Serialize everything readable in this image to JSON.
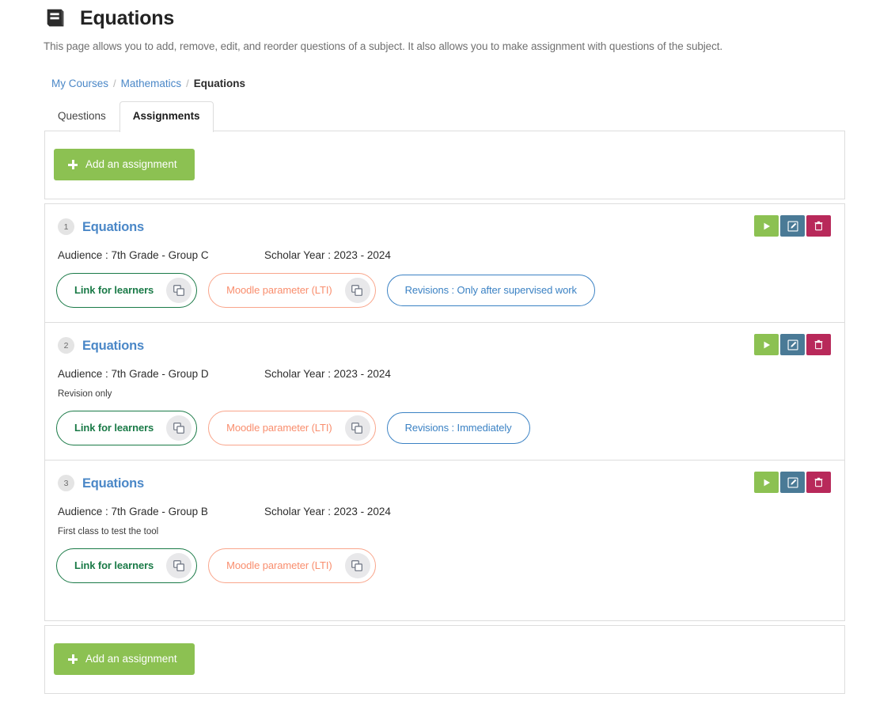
{
  "header": {
    "icon": "book-icon",
    "title": "Equations",
    "description": "This page allows you to add, remove, edit, and reorder questions of a subject. It also allows you to make assignment with questions of the subject."
  },
  "breadcrumb": {
    "items": [
      "My Courses",
      "Mathematics",
      "Equations"
    ],
    "separator": "/"
  },
  "tabs": [
    {
      "label": "Questions",
      "active": false
    },
    {
      "label": "Assignments",
      "active": true
    }
  ],
  "toolbar": {
    "add_label": "Add an assignment",
    "add_icon": "plus-icon",
    "add_color": "#8cc152"
  },
  "assignments": [
    {
      "number": "1",
      "title": "Equations",
      "audience": "Audience : 7th Grade - Group C",
      "scholar_year": "Scholar Year : 2023 - 2024",
      "note": "",
      "pills": [
        {
          "label": "Link for learners",
          "style": "green",
          "icon": "copy-icon",
          "has_icon": true
        },
        {
          "label": "Moodle parameter (LTI)",
          "style": "orange",
          "icon": "copy-icon",
          "has_icon": true
        },
        {
          "label": "Revisions : Only after supervised work",
          "style": "blue",
          "has_icon": false
        }
      ],
      "actions": [
        {
          "name": "play-button",
          "icon": "play-icon",
          "color": "#8cc152"
        },
        {
          "name": "edit-button",
          "icon": "pencil-square-icon",
          "color": "#4a7a96"
        },
        {
          "name": "delete-button",
          "icon": "trash-icon",
          "color": "#b8295a"
        }
      ]
    },
    {
      "number": "2",
      "title": "Equations",
      "audience": "Audience : 7th Grade - Group D",
      "scholar_year": "Scholar Year : 2023 - 2024",
      "note": "Revision only",
      "pills": [
        {
          "label": "Link for learners",
          "style": "green",
          "icon": "copy-icon",
          "has_icon": true
        },
        {
          "label": "Moodle parameter (LTI)",
          "style": "orange",
          "icon": "copy-icon",
          "has_icon": true
        },
        {
          "label": "Revisions : Immediately",
          "style": "blue",
          "has_icon": false
        }
      ],
      "actions": [
        {
          "name": "play-button",
          "icon": "play-icon",
          "color": "#8cc152"
        },
        {
          "name": "edit-button",
          "icon": "pencil-square-icon",
          "color": "#4a7a96"
        },
        {
          "name": "delete-button",
          "icon": "trash-icon",
          "color": "#b8295a"
        }
      ]
    },
    {
      "number": "3",
      "title": "Equations",
      "audience": "Audience : 7th Grade - Group B",
      "scholar_year": "Scholar Year : 2023 - 2024",
      "note": "First class to test the tool",
      "pills": [
        {
          "label": "Link for learners",
          "style": "green",
          "icon": "copy-icon",
          "has_icon": true
        },
        {
          "label": "Moodle parameter (LTI)",
          "style": "orange",
          "icon": "copy-icon",
          "has_icon": true
        }
      ],
      "actions": [
        {
          "name": "play-button",
          "icon": "play-icon",
          "color": "#8cc152"
        },
        {
          "name": "edit-button",
          "icon": "pencil-square-icon",
          "color": "#4a7a96"
        },
        {
          "name": "delete-button",
          "icon": "trash-icon",
          "color": "#b8295a"
        }
      ]
    }
  ]
}
